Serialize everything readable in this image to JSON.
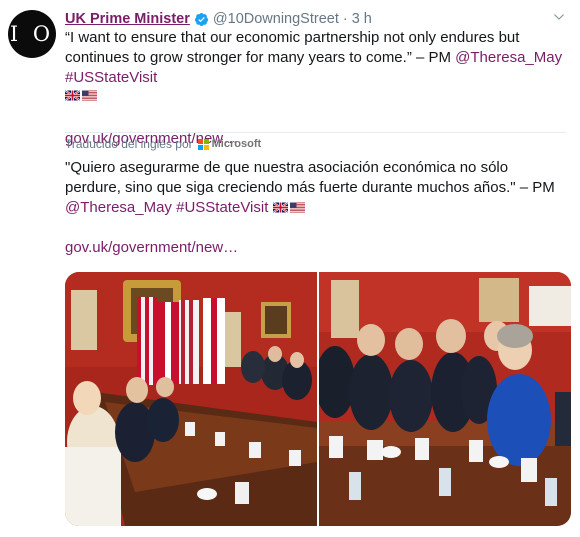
{
  "account": {
    "avatar_text": "I O",
    "name": "UK Prime Minister",
    "handle": "@10DowningStreet",
    "separator": "·",
    "time": "3 h"
  },
  "tweet": {
    "text_main": "“I want to ensure that our economic partnership not only endures but continues to grow stronger for many years to come.” – PM ",
    "mention": "@Theresa_May",
    "hashtag": "#USStateVisit",
    "url": "gov.uk/government/new…"
  },
  "translation": {
    "label": "Traducido del inglés por",
    "provider": "Microsoft",
    "text_main": "\"Quiero asegurarme de que nuestra asociación económica no sólo perdure, sino que siga creciendo más fuerte durante muchos años.\" – PM ",
    "mention": "@Theresa_May",
    "hashtag": "#USStateVisit",
    "url": "gov.uk/government/new…"
  },
  "colors": {
    "name": "#7a1d68",
    "link": "#7a1d68",
    "verified": "#1da1f2",
    "muted": "#657786"
  },
  "icons": [
    "verified-badge-icon",
    "chevron-down-icon",
    "microsoft-logo-icon",
    "uk-flag-icon",
    "us-flag-icon"
  ]
}
